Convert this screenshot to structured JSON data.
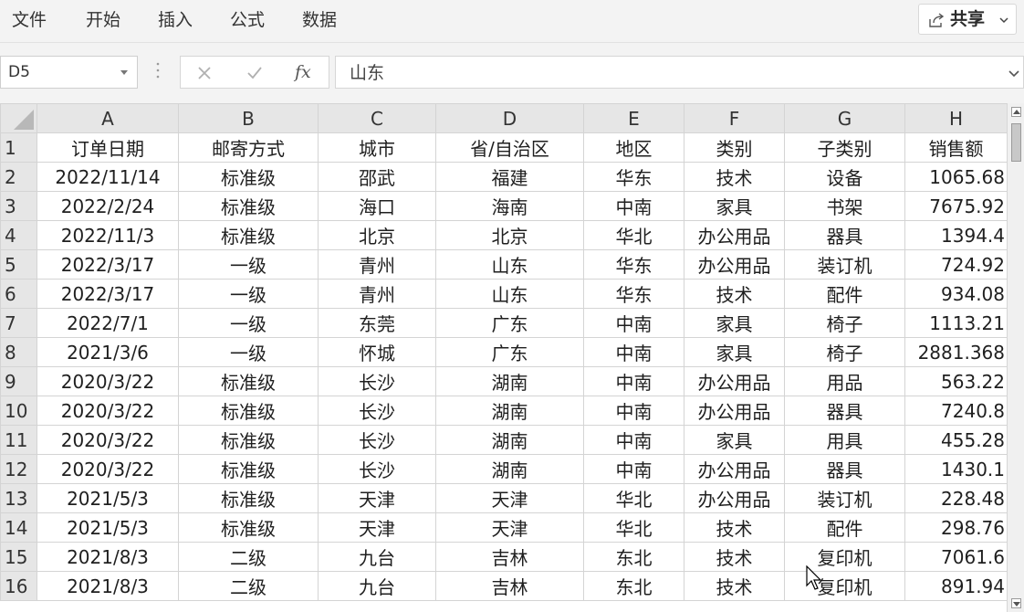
{
  "ribbon": {
    "tabs": [
      "文件",
      "开始",
      "插入",
      "公式",
      "数据"
    ],
    "share_label": "共享"
  },
  "formula_bar": {
    "name_box": "D5",
    "fx_label": "fx",
    "formula_value": "山东"
  },
  "sheet": {
    "column_headers": [
      "A",
      "B",
      "C",
      "D",
      "E",
      "F",
      "G",
      "H"
    ],
    "rows": [
      {
        "n": "1",
        "cells": [
          "订单日期",
          "邮寄方式",
          "城市",
          "省/自治区",
          "地区",
          "类别",
          "子类别",
          "销售额"
        ]
      },
      {
        "n": "2",
        "cells": [
          "2022/11/14",
          "标准级",
          "邵武",
          "福建",
          "华东",
          "技术",
          "设备",
          "1065.68"
        ]
      },
      {
        "n": "3",
        "cells": [
          "2022/2/24",
          "标准级",
          "海口",
          "海南",
          "中南",
          "家具",
          "书架",
          "7675.92"
        ]
      },
      {
        "n": "4",
        "cells": [
          "2022/11/3",
          "标准级",
          "北京",
          "北京",
          "华北",
          "办公用品",
          "器具",
          "1394.4"
        ]
      },
      {
        "n": "5",
        "cells": [
          "2022/3/17",
          "一级",
          "青州",
          "山东",
          "华东",
          "办公用品",
          "装订机",
          "724.92"
        ]
      },
      {
        "n": "6",
        "cells": [
          "2022/3/17",
          "一级",
          "青州",
          "山东",
          "华东",
          "技术",
          "配件",
          "934.08"
        ]
      },
      {
        "n": "7",
        "cells": [
          "2022/7/1",
          "一级",
          "东莞",
          "广东",
          "中南",
          "家具",
          "椅子",
          "1113.21"
        ]
      },
      {
        "n": "8",
        "cells": [
          "2021/3/6",
          "一级",
          "怀城",
          "广东",
          "中南",
          "家具",
          "椅子",
          "2881.368"
        ]
      },
      {
        "n": "9",
        "cells": [
          "2020/3/22",
          "标准级",
          "长沙",
          "湖南",
          "中南",
          "办公用品",
          "用品",
          "563.22"
        ]
      },
      {
        "n": "10",
        "cells": [
          "2020/3/22",
          "标准级",
          "长沙",
          "湖南",
          "中南",
          "办公用品",
          "器具",
          "7240.8"
        ]
      },
      {
        "n": "11",
        "cells": [
          "2020/3/22",
          "标准级",
          "长沙",
          "湖南",
          "中南",
          "家具",
          "用具",
          "455.28"
        ]
      },
      {
        "n": "12",
        "cells": [
          "2020/3/22",
          "标准级",
          "长沙",
          "湖南",
          "中南",
          "办公用品",
          "器具",
          "1430.1"
        ]
      },
      {
        "n": "13",
        "cells": [
          "2021/5/3",
          "标准级",
          "天津",
          "天津",
          "华北",
          "办公用品",
          "装订机",
          "228.48"
        ]
      },
      {
        "n": "14",
        "cells": [
          "2021/5/3",
          "标准级",
          "天津",
          "天津",
          "华北",
          "技术",
          "配件",
          "298.76"
        ]
      },
      {
        "n": "15",
        "cells": [
          "2021/8/3",
          "二级",
          "九台",
          "吉林",
          "东北",
          "技术",
          "复印机",
          "7061.6"
        ]
      },
      {
        "n": "16",
        "cells": [
          "2021/8/3",
          "二级",
          "九台",
          "吉林",
          "东北",
          "技术",
          "复印机",
          "891.94"
        ]
      }
    ]
  },
  "icons": {
    "share": "share-icon",
    "cancel": "cancel-x-icon",
    "enter": "checkmark-icon",
    "function": "fx-icon",
    "expand": "chevron-down-icon"
  }
}
